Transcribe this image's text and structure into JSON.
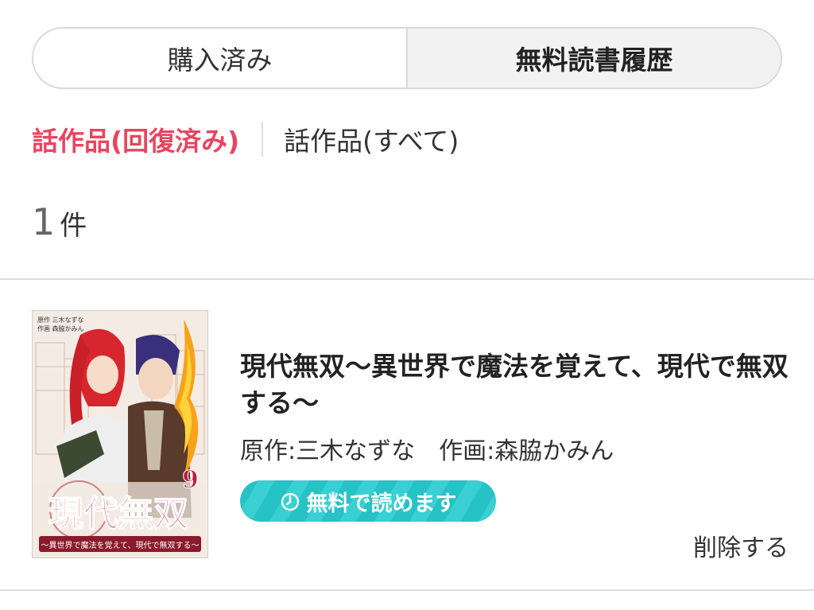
{
  "tabs": {
    "purchased": "購入済み",
    "free_history": "無料読書履歴"
  },
  "filters": {
    "recovered": "話作品(回復済み)",
    "all": "話作品(すべて)"
  },
  "count": {
    "number": "1",
    "unit": "件"
  },
  "item": {
    "title": "現代無双〜異世界で魔法を覚えて、現代で無双する〜",
    "author": "原作:三木なずな　作画:森脇かみん",
    "free_button": "無料で読めます",
    "free_button_icon": "timer-icon",
    "delete": "削除する",
    "cover": {
      "credit_line1": "原作 三木なずな",
      "credit_line2": "作画 森脇かみん",
      "title_logo": "現代無双",
      "volume": "9",
      "subtitle": "〜異世界で魔法を覚えて、現代で無双する〜"
    }
  },
  "colors": {
    "accent_pink": "#e8455f",
    "teal": "#27c2c6",
    "divider": "#dddddd"
  }
}
